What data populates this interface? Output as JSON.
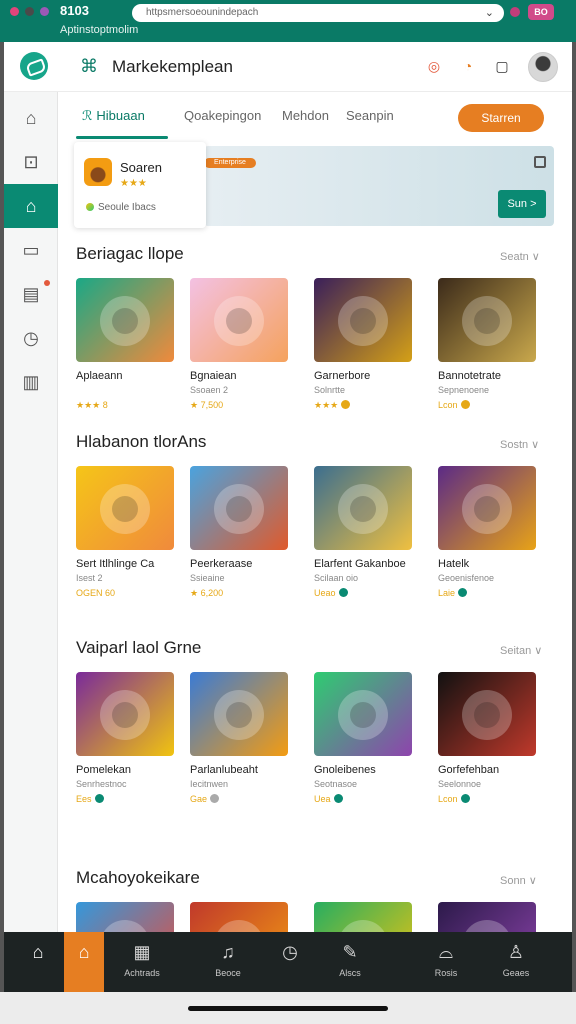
{
  "browser": {
    "time": "8103",
    "title": "Aptinstoptmolim",
    "url": "httpsmersoeounindepach",
    "badge": "BO",
    "dot_colors": [
      "#e0457b",
      "#4a4a4a",
      "#9b59b6"
    ]
  },
  "header": {
    "app_title": "Markekemplean",
    "icons": [
      "logo-icon",
      "gamepad-icon",
      "target-icon",
      "notification-icon",
      "controller-icon"
    ]
  },
  "sidebar": {
    "items": [
      "home-icon",
      "lock-icon",
      "store-icon",
      "wallet-icon",
      "calendar-icon",
      "compass-icon",
      "building-icon"
    ]
  },
  "tabs": {
    "items": [
      "Hibuaan",
      "Qoakepingon",
      "Mehdon",
      "Seanpin"
    ],
    "cta": "Starren"
  },
  "promo": {
    "title": "Soaren",
    "rating": "★★★",
    "caption": "Seoule Ibacs",
    "banner_pill": "Enterprise",
    "banner_button": "Sun >"
  },
  "sections": [
    {
      "title": "Beriagac llope",
      "more": "Seatn ∨",
      "games": [
        {
          "name": "Aplaeann",
          "sub": "",
          "meta": "★★★ 8",
          "colors": [
            "#1aa886",
            "#f08a3c"
          ],
          "badge": ""
        },
        {
          "name": "Bgnaiean",
          "sub": "Ssoaen 2",
          "meta": "★ 7,500",
          "colors": [
            "#f3c1e3",
            "#f5a25d"
          ],
          "badge": ""
        },
        {
          "name": "Garnerbore",
          "sub": "Solnrtte",
          "meta": "★★★",
          "colors": [
            "#3a1f5a",
            "#d4a017"
          ],
          "badge": "#e6a817"
        },
        {
          "name": "Bannotetrate",
          "sub": "Sepnenoene",
          "meta": "Lcon",
          "colors": [
            "#3b2a1a",
            "#c9a84c"
          ],
          "badge": "#e6a817"
        }
      ]
    },
    {
      "title": "Hlabanon tlorAns",
      "more": "Sostn ∨",
      "games": [
        {
          "name": "Sert Itlhlinge Ca",
          "sub": "Isest 2",
          "meta": "OGEN 60",
          "colors": [
            "#f5c518",
            "#f08a3c"
          ],
          "badge": ""
        },
        {
          "name": "Peerkeraase",
          "sub": "Ssieaine",
          "meta": "★ 6,200",
          "colors": [
            "#4aa3df",
            "#e05a2b"
          ],
          "badge": ""
        },
        {
          "name": "Elarfent Gakanboe",
          "sub": "Scilaan oio",
          "meta": "Ueao",
          "colors": [
            "#3b6e8f",
            "#f0c040"
          ],
          "badge": "#0a8a73"
        },
        {
          "name": "Hatelk",
          "sub": "Geoenisfenoe",
          "meta": "Laie",
          "colors": [
            "#5b2a86",
            "#e8a317"
          ],
          "badge": "#0a8a73"
        }
      ]
    },
    {
      "title": "Vaiparl laol Grne",
      "more": "Seitan ∨",
      "games": [
        {
          "name": "Pomelekan",
          "sub": "Senrhestnoc",
          "meta": "Ees",
          "colors": [
            "#7a2a9a",
            "#f1c40f"
          ],
          "badge": "#0a8a73"
        },
        {
          "name": "Parlanlubeaht",
          "sub": "Iecitnwen",
          "meta": "Gae",
          "colors": [
            "#3b7bd4",
            "#f39c12"
          ],
          "badge": "#aaaaaa"
        },
        {
          "name": "Gnoleibenes",
          "sub": "Seotnasoe",
          "meta": "Uea",
          "colors": [
            "#2ecc71",
            "#8e44ad"
          ],
          "badge": "#0a8a73"
        },
        {
          "name": "Gorfefehban",
          "sub": "Seelonnoe",
          "meta": "Lcon",
          "colors": [
            "#111111",
            "#c0392b"
          ],
          "badge": "#0a8a73"
        }
      ]
    },
    {
      "title": "Mcahoyokeikare",
      "more": "Sonn ∨",
      "games": [
        {
          "name": "",
          "sub": "",
          "meta": "",
          "colors": [
            "#3498db",
            "#e74c3c"
          ],
          "badge": ""
        },
        {
          "name": "",
          "sub": "",
          "meta": "",
          "colors": [
            "#c0392b",
            "#f39c12"
          ],
          "badge": ""
        },
        {
          "name": "",
          "sub": "",
          "meta": "",
          "colors": [
            "#27ae60",
            "#f1c40f"
          ],
          "badge": ""
        },
        {
          "name": "",
          "sub": "",
          "meta": "",
          "colors": [
            "#2c1a4a",
            "#8e44ad"
          ],
          "badge": ""
        }
      ]
    }
  ],
  "bottom_nav": {
    "items": [
      {
        "label": "",
        "icon": "home-icon"
      },
      {
        "label": "",
        "icon": "house-outline-icon"
      },
      {
        "label": "Achtrads",
        "icon": "grid-icon"
      },
      {
        "label": "Beoce",
        "icon": "music-icon"
      },
      {
        "label": "",
        "icon": "compass-icon"
      },
      {
        "label": "Alscs",
        "icon": "edit-icon"
      },
      {
        "label": "Rosis",
        "icon": "basket-icon"
      },
      {
        "label": "Geaes",
        "icon": "user-icon"
      }
    ]
  }
}
